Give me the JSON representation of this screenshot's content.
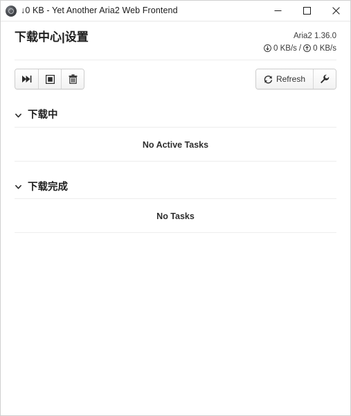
{
  "window": {
    "title": "↓0 KB - Yet Another Aria2 Web Frontend",
    "app_icon": "aria2-app-icon",
    "controls": {
      "minimize": "minimize-icon",
      "maximize": "maximize-icon",
      "close": "close-icon"
    }
  },
  "header": {
    "page_title": "下载中心|设置",
    "version": "Aria2 1.36.0",
    "download_speed": "0 KB/s",
    "separator": "/",
    "upload_speed": "0 KB/s",
    "download_icon": "circle-arrow-down-icon",
    "upload_icon": "circle-arrow-up-icon"
  },
  "toolbar": {
    "left_buttons": [
      {
        "name": "resume-button",
        "icon": "fast-forward-icon",
        "label": ""
      },
      {
        "name": "stop-button",
        "icon": "stop-square-icon",
        "label": ""
      },
      {
        "name": "delete-button",
        "icon": "trash-icon",
        "label": ""
      }
    ],
    "refresh_label": "Refresh",
    "refresh_icon": "refresh-icon",
    "settings_icon": "wrench-icon"
  },
  "sections": [
    {
      "title": "下载中",
      "expanded": true,
      "chevron": "chevron-down-icon",
      "empty_text": "No Active Tasks"
    },
    {
      "title": "下载完成",
      "expanded": true,
      "chevron": "chevron-down-icon",
      "empty_text": "No Tasks"
    }
  ],
  "colors": {
    "window_border": "#cfcfcf",
    "text_primary": "#1f1f1f",
    "text_secondary": "#3a3a3a",
    "rule": "#ededed",
    "button_border": "#cccccc",
    "close_hover": "#e81123"
  }
}
